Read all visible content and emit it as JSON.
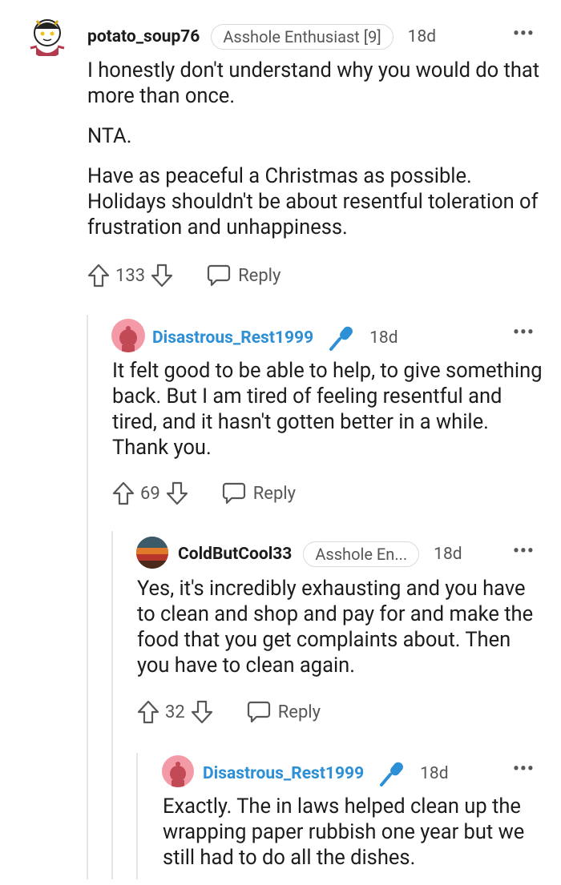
{
  "comments": [
    {
      "username": "potato_soup76",
      "flair": "Asshole Enthusiast [9]",
      "time": "18d",
      "paragraphs": [
        "I honestly don't understand why you would do that more than once.",
        "NTA.",
        "Have as peaceful a Christmas as possible. Holidays shouldn't be about resentful toleration of frustration and unhappiness."
      ],
      "votes": "133",
      "reply_label": "Reply"
    },
    {
      "username": "Disastrous_Rest1999",
      "time": "18d",
      "paragraphs": [
        "It felt good to be able to help, to give something back. But I am tired of feeling resentful and tired, and it hasn't gotten better in a while. Thank you."
      ],
      "votes": "69",
      "reply_label": "Reply"
    },
    {
      "username": "ColdButCool33",
      "flair": "Asshole En...",
      "time": "18d",
      "paragraphs": [
        "Yes, it's incredibly exhausting and you have to clean and shop and pay for and make the food that you get complaints about. Then you have to clean again."
      ],
      "votes": "32",
      "reply_label": "Reply"
    },
    {
      "username": "Disastrous_Rest1999",
      "time": "18d",
      "paragraphs": [
        "Exactly. The in laws helped clean up the wrapping paper rubbish one year but we still had to do all the dishes."
      ]
    }
  ],
  "more_label": "•••",
  "colors": {
    "op_blue": "#2d8fd5",
    "text": "#1c1c1c",
    "meta": "#575757",
    "thread": "#e4e6e8"
  }
}
